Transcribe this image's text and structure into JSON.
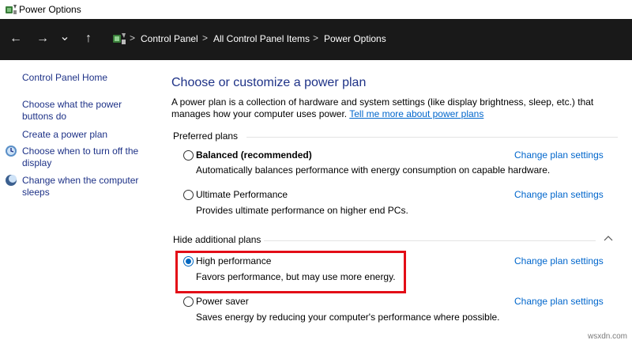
{
  "window": {
    "title": "Power Options"
  },
  "address_bar": {
    "crumbs": [
      "Control Panel",
      "All Control Panel Items",
      "Power Options"
    ],
    "separator": ">"
  },
  "nav": {
    "back": "←",
    "forward": "→",
    "recent": "⌄",
    "up": "↑"
  },
  "sidebar": {
    "home": "Control Panel Home",
    "links": [
      "Choose what the power buttons do",
      "Create a power plan",
      "Choose when to turn off the display",
      "Change when the computer sleeps"
    ]
  },
  "main": {
    "heading": "Choose or customize a power plan",
    "description": "A power plan is a collection of hardware and system settings (like display brightness, sleep, etc.) that manages how your computer uses power.",
    "description_link": "Tell me more about power plans",
    "preferred_label": "Preferred plans",
    "additional_label": "Hide additional plans",
    "change_label": "Change plan settings",
    "plans": [
      {
        "name": "Balanced (recommended)",
        "desc": "Automatically balances performance with energy consumption on capable hardware.",
        "selected": false
      },
      {
        "name": "Ultimate Performance",
        "desc": "Provides ultimate performance on higher end PCs.",
        "selected": false
      },
      {
        "name": "High performance",
        "desc": "Favors performance, but may use more energy.",
        "selected": true
      },
      {
        "name": "Power saver",
        "desc": "Saves energy by reducing your computer's performance where possible.",
        "selected": false
      }
    ]
  },
  "colors": {
    "accent": "#0067c0",
    "link": "#0066cc",
    "heading": "#1e3287",
    "highlight": "#e30d17",
    "address_bg": "#191919"
  },
  "watermark": "wsxdn.com"
}
